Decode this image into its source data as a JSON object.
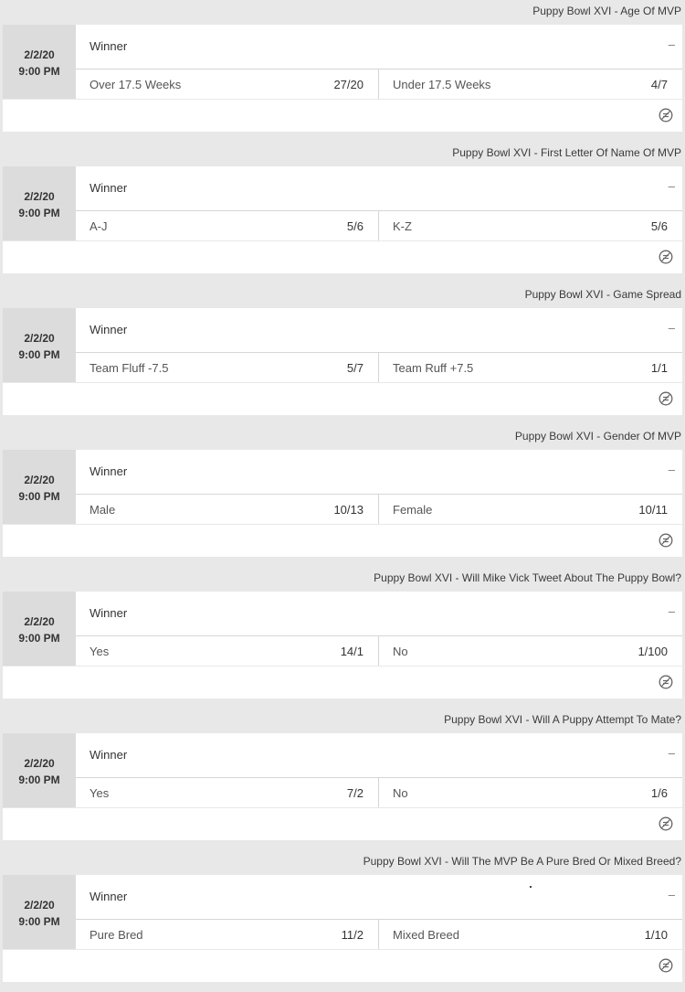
{
  "markets": [
    {
      "title": "Puppy Bowl XVI - Age Of MVP",
      "date": "2/2/20",
      "time": "9:00 PM",
      "winner_label": "Winner",
      "winner_odds": "–",
      "options": [
        {
          "label": "Over 17.5 Weeks",
          "odds": "27/20"
        },
        {
          "label": "Under 17.5 Weeks",
          "odds": "4/7"
        }
      ],
      "footer_icon": "stats-icon"
    },
    {
      "title": "Puppy Bowl XVI - First Letter Of Name Of MVP",
      "date": "2/2/20",
      "time": "9:00 PM",
      "winner_label": "Winner",
      "winner_odds": "–",
      "options": [
        {
          "label": "A-J",
          "odds": "5/6"
        },
        {
          "label": "K-Z",
          "odds": "5/6"
        }
      ],
      "footer_icon": "stats-icon"
    },
    {
      "title": "Puppy Bowl XVI - Game Spread",
      "date": "2/2/20",
      "time": "9:00 PM",
      "winner_label": "Winner",
      "winner_odds": "–",
      "options": [
        {
          "label": "Team Fluff -7.5",
          "odds": "5/7"
        },
        {
          "label": "Team Ruff +7.5",
          "odds": "1/1"
        }
      ],
      "footer_icon": "stats-icon"
    },
    {
      "title": "Puppy Bowl XVI - Gender Of MVP",
      "date": "2/2/20",
      "time": "9:00 PM",
      "winner_label": "Winner",
      "winner_odds": "–",
      "options": [
        {
          "label": "Male",
          "odds": "10/13"
        },
        {
          "label": "Female",
          "odds": "10/11"
        }
      ],
      "footer_icon": "stats-icon"
    },
    {
      "title": "Puppy Bowl XVI - Will Mike Vick Tweet About The Puppy Bowl?",
      "date": "2/2/20",
      "time": "9:00 PM",
      "winner_label": "Winner",
      "winner_odds": "–",
      "options": [
        {
          "label": "Yes",
          "odds": "14/1"
        },
        {
          "label": "No",
          "odds": "1/100"
        }
      ],
      "footer_icon": "stats-icon"
    },
    {
      "title": "Puppy Bowl XVI - Will A Puppy Attempt To Mate?",
      "date": "2/2/20",
      "time": "9:00 PM",
      "winner_label": "Winner",
      "winner_odds": "–",
      "options": [
        {
          "label": "Yes",
          "odds": "7/2"
        },
        {
          "label": "No",
          "odds": "1/6"
        }
      ],
      "footer_icon": "stats-icon"
    },
    {
      "title": "Puppy Bowl XVI - Will The MVP Be A Pure Bred Or Mixed Breed?",
      "date": "2/2/20",
      "time": "9:00 PM",
      "winner_label": "Winner",
      "winner_odds": "–",
      "options": [
        {
          "label": "Pure Bred",
          "odds": "11/2"
        },
        {
          "label": "Mixed Breed",
          "odds": "1/10"
        }
      ],
      "footer_icon": "stats-icon"
    }
  ]
}
